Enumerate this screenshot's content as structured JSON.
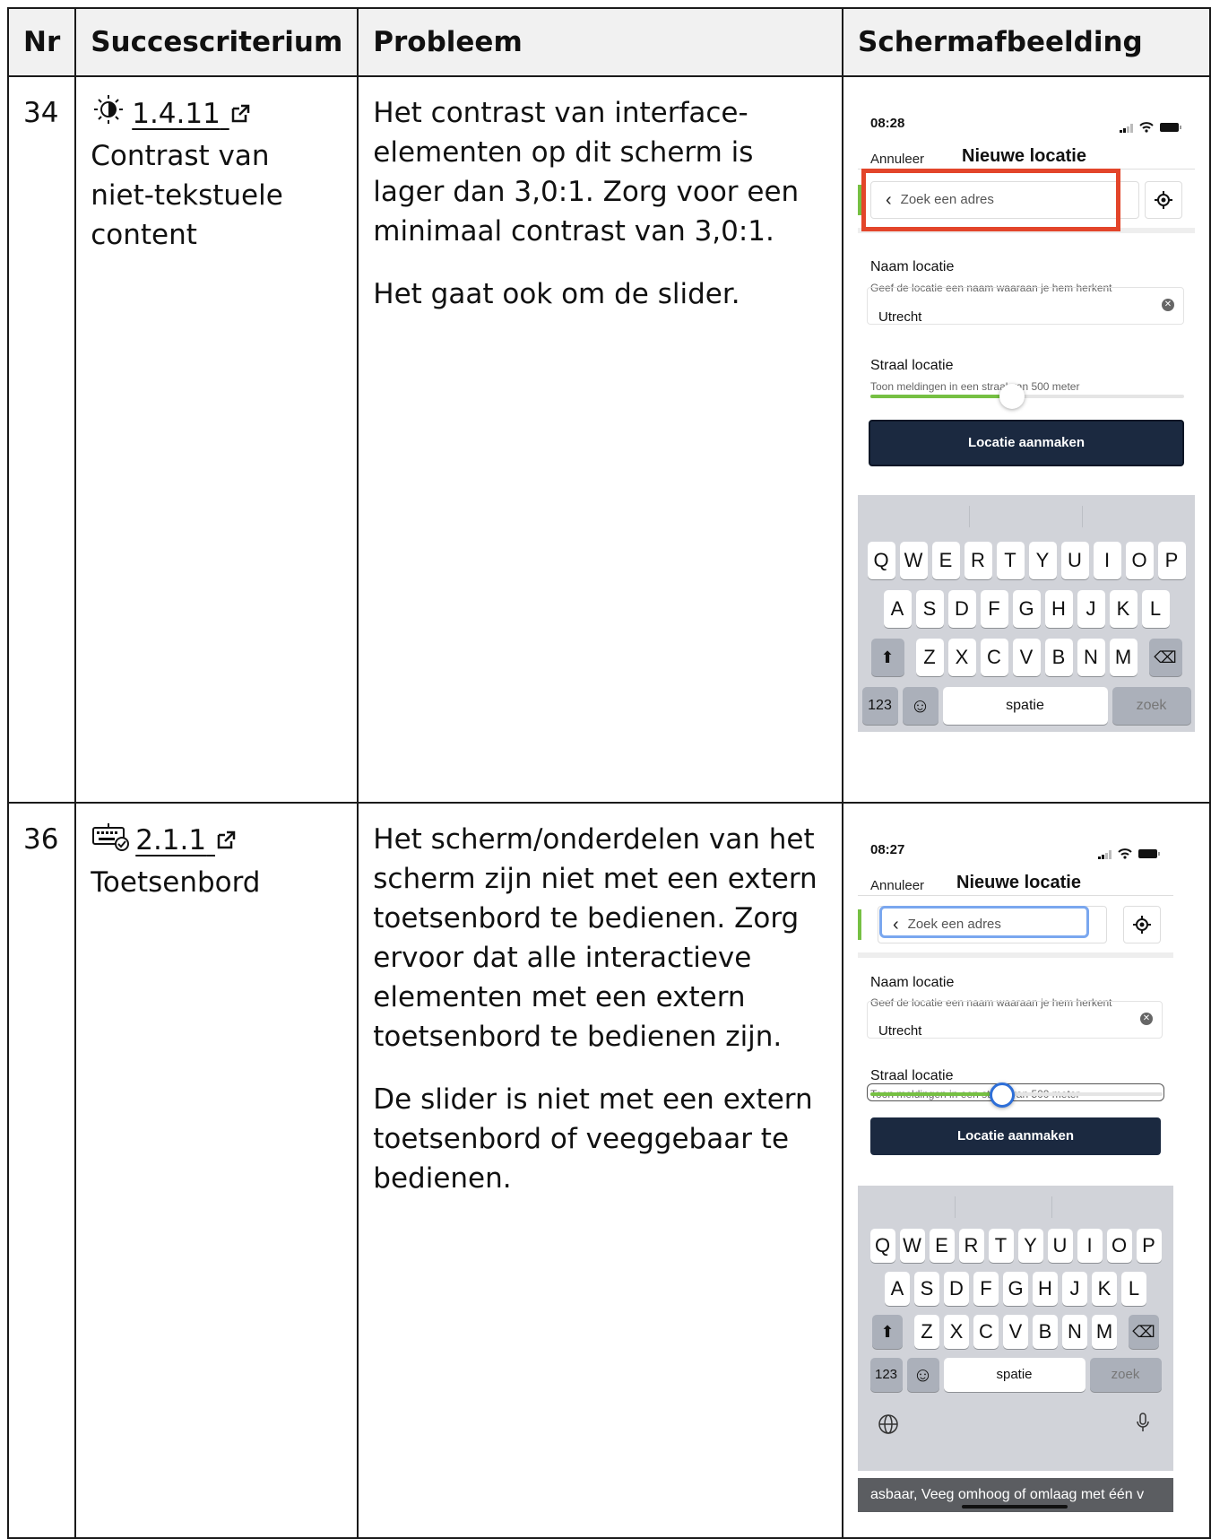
{
  "table": {
    "headers": [
      "Nr",
      "Succescriterium",
      "Probleem",
      "Schermafbeelding"
    ],
    "rows": [
      {
        "nr": "34",
        "criterion_icon": "contrast-sun-icon",
        "criterion_code": "1.4.11",
        "criterion_name": "Contrast van niet-tekstuele content",
        "problem": [
          "Het contrast van interface-elementen op dit scherm is lager dan 3,0:1. Zorg voor een minimaal contrast van 3,0:1.",
          "Het gaat ook om de slider."
        ],
        "screenshot": {
          "time": "08:28",
          "cancel": "Annuleer",
          "title": "Nieuwe locatie",
          "search_placeholder": "Zoek een adres",
          "name_label": "Naam locatie",
          "name_hint": "Geef de locatie een naam waaraan je hem herkent",
          "name_value": "Utrecht",
          "radius_label": "Straal locatie",
          "radius_hint": "Toon meldingen in een straal van 500 meter",
          "slider_fraction": 0.45,
          "button": "Locatie aanmaken",
          "highlight_color": "#e3452a"
        }
      },
      {
        "nr": "36",
        "criterion_icon": "keyboard-check-icon",
        "criterion_code": "2.1.1",
        "criterion_name": "Toetsenbord",
        "problem": [
          "Het scherm/onderdelen van het scherm zijn niet met een extern toetsenbord te bedienen. Zorg ervoor dat alle interactieve elementen met een extern toetsenbord te bedienen zijn.",
          "De slider is niet met een extern toetsenbord of veeggebaar te bedienen."
        ],
        "screenshot": {
          "time": "08:27",
          "cancel": "Annuleer",
          "title": "Nieuwe locatie",
          "search_placeholder": "Zoek een adres",
          "name_label": "Naam locatie",
          "name_hint": "Geef de locatie een naam waaraan je hem herkent",
          "name_value": "Utrecht",
          "radius_label": "Straal locatie",
          "radius_hint": "Toon meldingen in een straal van 500 meter",
          "slider_fraction": 0.45,
          "button": "Locatie aanmaken",
          "voiceover_text": "asbaar, Veeg omhoog of omlaag met één v"
        }
      }
    ]
  },
  "keyboard": {
    "row1": [
      "Q",
      "W",
      "E",
      "R",
      "T",
      "Y",
      "U",
      "I",
      "O",
      "P"
    ],
    "row2": [
      "A",
      "S",
      "D",
      "F",
      "G",
      "H",
      "J",
      "K",
      "L"
    ],
    "row3": [
      "Z",
      "X",
      "C",
      "V",
      "B",
      "N",
      "M"
    ],
    "numbers_key": "123",
    "space_key": "spatie",
    "search_key": "zoek"
  },
  "colors": {
    "accent_green": "#76c043",
    "cta_navy": "#1b2940",
    "focus_blue": "#7aa7ef"
  }
}
